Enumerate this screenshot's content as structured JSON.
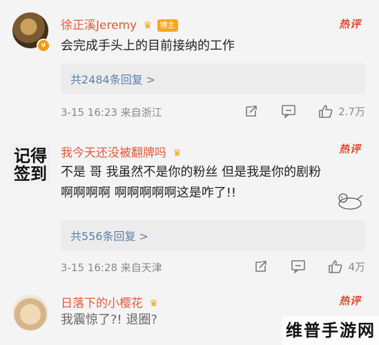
{
  "comments": [
    {
      "name": "徐正溪Jeremy",
      "badge": "博主",
      "hot": "热评",
      "text": "会完成手头上的目前接纳的工作",
      "reply_link": "共2484条回复 >",
      "meta": "3-15 16:23 来自浙江",
      "likes": "2.7万"
    },
    {
      "avatar_text": "记得\n签到",
      "name": "我今天还没被翻牌吗",
      "hot": "热评",
      "text": "不是 哥 我虽然不是你的粉丝 但是我是你的剧粉啊啊啊啊 啊啊啊啊啊这是咋了!!",
      "reply_link": "共556条回复 >",
      "meta": "3-15 16:28 来自天津",
      "likes": "4万"
    },
    {
      "name": "日落下的小樱花",
      "hot": "热评",
      "text": "我震惊了?! 退圈?"
    }
  ],
  "watermark": "维普手游网",
  "icons": {
    "share": "share-icon",
    "comment": "comment-icon",
    "like": "like-icon",
    "crown": "crown-icon"
  }
}
